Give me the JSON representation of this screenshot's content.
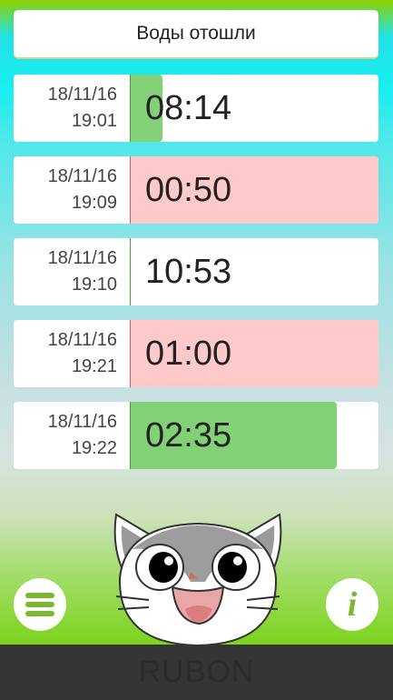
{
  "top_button": {
    "label": "Воды отошли"
  },
  "contractions": [
    {
      "date": "18/11/16",
      "time": "19:01",
      "duration": "08:14",
      "status": "normal",
      "level": 0.13
    },
    {
      "date": "18/11/16",
      "time": "19:09",
      "duration": "00:50",
      "status": "alert",
      "level": 0
    },
    {
      "date": "18/11/16",
      "time": "19:10",
      "duration": "10:53",
      "status": "normal",
      "level": 0
    },
    {
      "date": "18/11/16",
      "time": "19:21",
      "duration": "01:00",
      "status": "alert",
      "level": 0
    },
    {
      "date": "18/11/16",
      "time": "19:22",
      "duration": "02:35",
      "status": "normal",
      "level": 0.83
    }
  ],
  "menu_button": {
    "icon": "hamburger-menu-icon"
  },
  "info_button": {
    "icon": "info-icon",
    "glyph": "i"
  },
  "mascot": {
    "icon": "cat-face-icon"
  },
  "bottom_bar": {
    "text": "RUBON"
  },
  "colors": {
    "green_fill": "#82d177",
    "red_bg": "#fec9c9",
    "accent_green": "#7ed321"
  }
}
